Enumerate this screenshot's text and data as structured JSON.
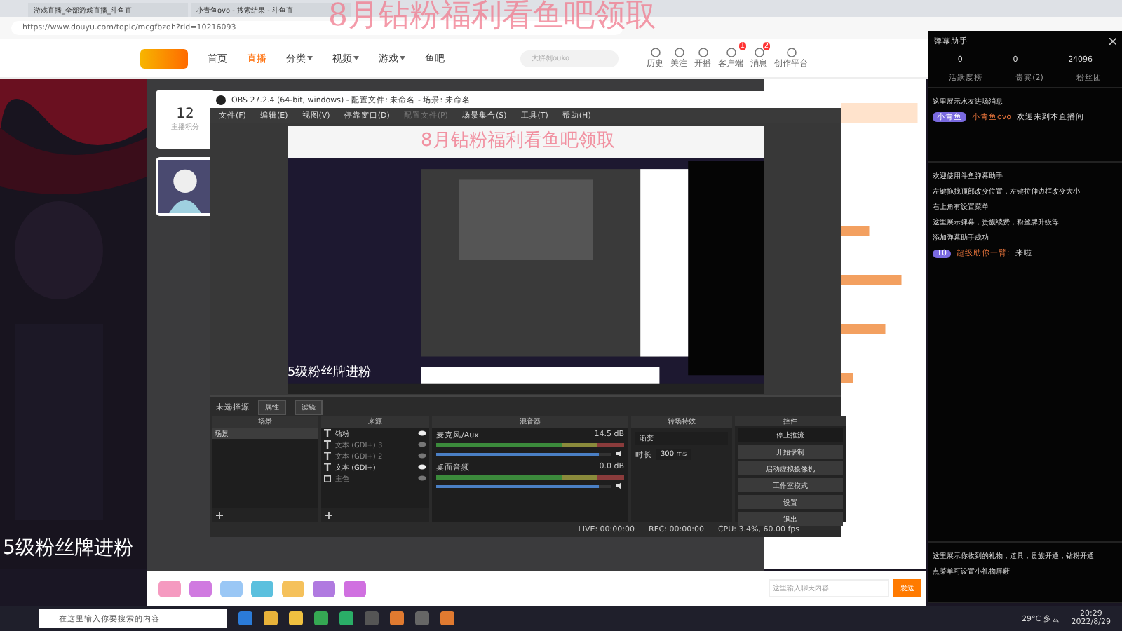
{
  "banner": "8月钻粉福利看鱼吧领取",
  "browser": {
    "tabs": [
      {
        "label": "游戏直播_全部游戏直播_斗鱼直",
        "selected": false
      },
      {
        "label": "小青鱼ovo - 搜索结果 - 斗鱼直",
        "selected": false
      }
    ],
    "url": "https://www.douyu.com/topic/mcgfbzdh?rid=10216093"
  },
  "site": {
    "nav": [
      {
        "label": "首页",
        "selected": false,
        "dropdown": false
      },
      {
        "label": "直播",
        "selected": true,
        "dropdown": false
      },
      {
        "label": "分类",
        "selected": false,
        "dropdown": true
      },
      {
        "label": "视频",
        "selected": false,
        "dropdown": true
      },
      {
        "label": "游戏",
        "selected": false,
        "dropdown": true
      },
      {
        "label": "鱼吧",
        "selected": false,
        "dropdown": false
      }
    ],
    "search_placeholder": "大胖刹ouko",
    "header_icons": [
      {
        "label": "历史"
      },
      {
        "label": "关注"
      },
      {
        "label": "开播"
      },
      {
        "label": "客户端",
        "badge": "1"
      },
      {
        "label": "消息",
        "badge": "2"
      },
      {
        "label": "创作平台"
      }
    ],
    "score": {
      "value": "12",
      "label": "主播积分"
    },
    "chat_input": {
      "placeholder": "这里输入聊天内容",
      "button": "发送"
    }
  },
  "obs": {
    "title": "OBS 27.2.4 (64-bit, windows) - 配置文件: 未命名 - 场景: 未命名",
    "menu": [
      {
        "label": "文件(F)",
        "disabled": false
      },
      {
        "label": "编辑(E)",
        "disabled": false
      },
      {
        "label": "视图(V)",
        "disabled": false
      },
      {
        "label": "停靠窗口(D)",
        "disabled": false
      },
      {
        "label": "配置文件(P)",
        "disabled": true
      },
      {
        "label": "场景集合(S)",
        "disabled": false
      },
      {
        "label": "工具(T)",
        "disabled": false
      },
      {
        "label": "帮助(H)",
        "disabled": false
      }
    ],
    "preview_texts": [
      "8月钻粉福利看鱼吧领取",
      "5级粉丝牌进粉"
    ],
    "source_bar": {
      "label": "未选择源",
      "buttons": [
        "属性",
        "滤镜"
      ]
    },
    "scenes": {
      "title": "场景",
      "items": [
        "场景"
      ]
    },
    "sources": {
      "title": "来源",
      "items": [
        {
          "name": "钻粉",
          "kind": "text",
          "visible": true
        },
        {
          "name": "文本 (GDI+) 3",
          "kind": "text",
          "visible": false
        },
        {
          "name": "文本 (GDI+) 2",
          "kind": "text",
          "visible": false
        },
        {
          "name": "文本 (GDI+)",
          "kind": "text",
          "visible": true
        },
        {
          "name": "主色",
          "kind": "window",
          "visible": false
        }
      ]
    },
    "mixer": {
      "title": "混音器",
      "channels": [
        {
          "name": "麦克风/Aux",
          "reading": "14.5 dB",
          "level": 0.93
        },
        {
          "name": "桌面音频",
          "reading": "0.0 dB",
          "level": 0.93
        }
      ]
    },
    "transitions": {
      "title": "转场特效",
      "select": "渐变",
      "duration_label": "时长",
      "duration": "300 ms"
    },
    "controls": {
      "title": "控件",
      "buttons": [
        {
          "label": "停止推流",
          "active": true
        },
        {
          "label": "开始录制",
          "active": false
        },
        {
          "label": "启动虚拟摄像机",
          "active": false
        },
        {
          "label": "工作室模式",
          "active": false
        },
        {
          "label": "设置",
          "active": false
        },
        {
          "label": "退出",
          "active": false
        }
      ]
    },
    "status": [
      "LIVE: 00:00:00",
      "REC: 00:00:00",
      "CPU: 3.4%, 60.00 fps"
    ]
  },
  "chat": {
    "title": "弹幕助手",
    "stats": [
      "0",
      "0",
      "24096"
    ],
    "tabs": [
      "活跃度榜",
      "贵宾(2)",
      "粉丝团"
    ],
    "sections": [
      {
        "lines": [
          "这里展示水友进场消息"
        ],
        "entry": {
          "badge": "小青鱼",
          "name": "小青鱼ovo",
          "text": "欢迎来到本直播间"
        }
      },
      {
        "lines": [
          "欢迎使用斗鱼弹幕助手",
          "左键拖拽顶部改变位置，左键拉伸边框改变大小",
          "右上角有设置菜单",
          "这里展示弹幕，贵族续费，粉丝牌升级等",
          "添加弹幕助手成功"
        ],
        "entry": {
          "badge": "10",
          "name": "超级助你一臂:",
          "text": "来啦"
        }
      },
      {
        "lines": [
          "这里展示你收到的礼物，道具，贵族开通，钻粉开通",
          "点菜单可设置小礼物屏蔽"
        ]
      }
    ]
  },
  "stream_overlay": "5级粉丝牌进粉",
  "taskbar": {
    "search_placeholder": "在这里输入你要搜索的内容",
    "weather": "29°C 多云",
    "time": "20:29",
    "date": "2022/8/29"
  }
}
